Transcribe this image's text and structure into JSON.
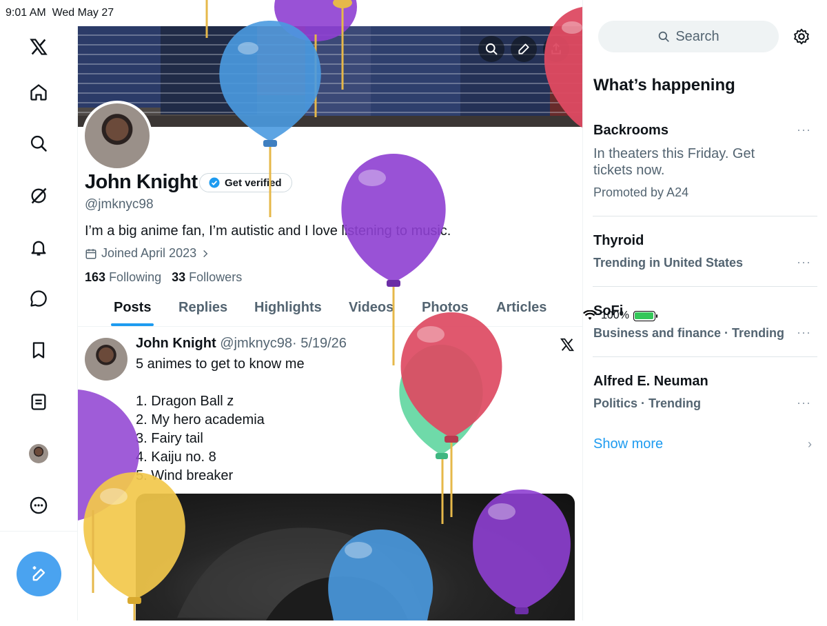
{
  "status_bar": {
    "time": "9:01 AM",
    "date": "Wed May 27",
    "battery": "100%"
  },
  "nav": {
    "items": [
      "x-logo",
      "home",
      "search",
      "grok",
      "notifications",
      "messages",
      "bookmarks",
      "lists",
      "profile",
      "more"
    ],
    "compose": "compose"
  },
  "profile": {
    "name": "John Knight",
    "verify_label": "Get verified",
    "handle": "@jmknyc98",
    "bio": "I’m a big anime fan, I’m autistic and I love listening to music.",
    "joined": "Joined April 2023",
    "following_count": "163",
    "following_label": "Following",
    "followers_count": "33",
    "followers_label": "Followers"
  },
  "tabs": [
    "Posts",
    "Replies",
    "Highlights",
    "Videos",
    "Photos",
    "Articles"
  ],
  "post": {
    "author": "John Knight",
    "handle": "@jmknyc98",
    "date": "· 5/19/26",
    "lines": [
      "5 animes to get to know me",
      "1. Dragon Ball z",
      "2. My hero academia",
      "3. Fairy tail",
      "4. Kaiju no. 8",
      "5. Wind breaker"
    ]
  },
  "right": {
    "search_placeholder": "Search",
    "heading": "What’s happening",
    "trends": [
      {
        "title": "Backrooms",
        "sub1": "In theaters this Friday. Get",
        "sub2": "tickets now.",
        "sub3": "Promoted by A24"
      },
      {
        "title": "Thyroid",
        "sub": "Trending in United States"
      },
      {
        "title": "SoFi",
        "sub": "Business and finance · Trending"
      },
      {
        "title": "Alfred E. Neuman",
        "sub": "Politics · Trending"
      }
    ],
    "show_more": "Show more",
    "more_dots": "···"
  },
  "colors": {
    "accent": "#1d9bf0",
    "balloon_purple": "#8e3fd1",
    "balloon_blue": "#4a9ae0",
    "balloon_red": "#dd4a62",
    "balloon_green": "#5fd6a0",
    "balloon_yellow": "#f2c84b"
  }
}
